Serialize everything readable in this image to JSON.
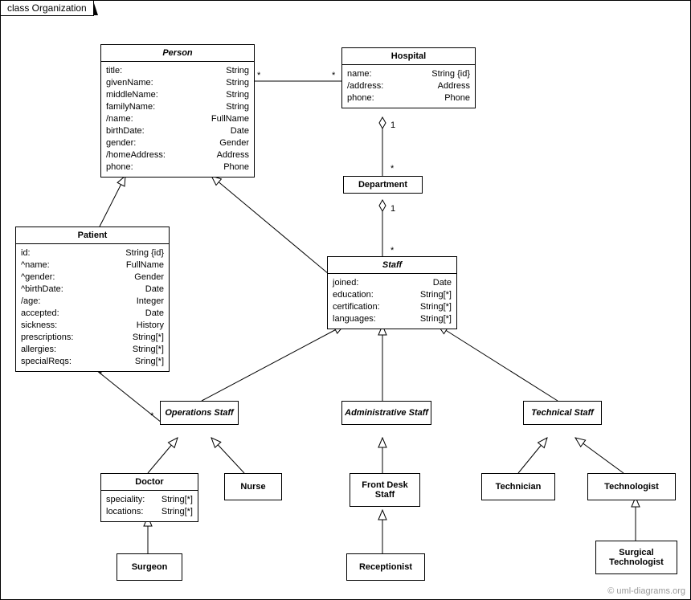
{
  "frameTitle": "class Organization",
  "watermark": "© uml-diagrams.org",
  "classes": {
    "person": {
      "name": "Person",
      "attrs": [
        {
          "n": "title:",
          "t": "String"
        },
        {
          "n": "givenName:",
          "t": "String"
        },
        {
          "n": "middleName:",
          "t": "String"
        },
        {
          "n": "familyName:",
          "t": "String"
        },
        {
          "n": "/name:",
          "t": "FullName"
        },
        {
          "n": "birthDate:",
          "t": "Date"
        },
        {
          "n": "gender:",
          "t": "Gender"
        },
        {
          "n": "/homeAddress:",
          "t": "Address"
        },
        {
          "n": "phone:",
          "t": "Phone"
        }
      ]
    },
    "hospital": {
      "name": "Hospital",
      "attrs": [
        {
          "n": "name:",
          "t": "String {id}"
        },
        {
          "n": "/address:",
          "t": "Address"
        },
        {
          "n": "phone:",
          "t": "Phone"
        }
      ]
    },
    "department": {
      "name": "Department"
    },
    "patient": {
      "name": "Patient",
      "attrs": [
        {
          "n": "id:",
          "t": "String {id}"
        },
        {
          "n": "^name:",
          "t": "FullName"
        },
        {
          "n": "^gender:",
          "t": "Gender"
        },
        {
          "n": "^birthDate:",
          "t": "Date"
        },
        {
          "n": "/age:",
          "t": "Integer"
        },
        {
          "n": "accepted:",
          "t": "Date"
        },
        {
          "n": "sickness:",
          "t": "History"
        },
        {
          "n": "prescriptions:",
          "t": "String[*]"
        },
        {
          "n": "allergies:",
          "t": "String[*]"
        },
        {
          "n": "specialReqs:",
          "t": "Sring[*]"
        }
      ]
    },
    "staff": {
      "name": "Staff",
      "attrs": [
        {
          "n": "joined:",
          "t": "Date"
        },
        {
          "n": "education:",
          "t": "String[*]"
        },
        {
          "n": "certification:",
          "t": "String[*]"
        },
        {
          "n": "languages:",
          "t": "String[*]"
        }
      ]
    },
    "opsStaff": {
      "name": "Operations Staff"
    },
    "adminStaff": {
      "name": "Administrative Staff"
    },
    "techStaff": {
      "name": "Technical Staff"
    },
    "doctor": {
      "name": "Doctor",
      "attrs": [
        {
          "n": "speciality:",
          "t": "String[*]"
        },
        {
          "n": "locations:",
          "t": "String[*]"
        }
      ]
    },
    "nurse": {
      "name": "Nurse"
    },
    "frontDesk": {
      "name": "Front Desk Staff"
    },
    "technician": {
      "name": "Technician"
    },
    "technologist": {
      "name": "Technologist"
    },
    "surgeon": {
      "name": "Surgeon"
    },
    "receptionist": {
      "name": "Receptionist"
    },
    "surgTech": {
      "name": "Surgical Technologist"
    }
  },
  "multiplicities": {
    "starA": "*",
    "one1": "1",
    "starB": "*",
    "one2": "1",
    "starC": "*",
    "starD": "*",
    "starE": "*"
  }
}
